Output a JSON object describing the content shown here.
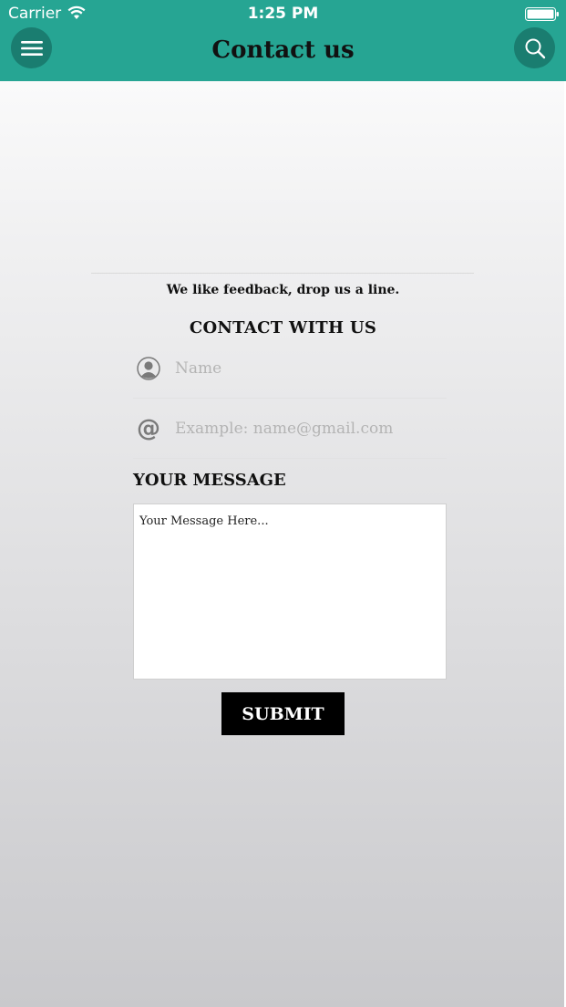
{
  "status_bar": {
    "carrier": "Carrier",
    "time": "1:25 PM"
  },
  "header": {
    "title": "Contact us",
    "menu_icon": "hamburger-menu-icon",
    "search_icon": "search-icon",
    "color": "#26a593"
  },
  "content": {
    "tagline": "We like feedback, drop us a line.",
    "section_title": "CONTACT WITH US",
    "name_field": {
      "icon": "user-icon",
      "placeholder": "Name",
      "value": ""
    },
    "email_field": {
      "icon": "at-icon",
      "icon_glyph": "@",
      "placeholder": "Example: name@gmail.com",
      "value": ""
    },
    "message_label": "YOUR MESSAGE",
    "message_placeholder": "Your Message Here...",
    "submit_label": "SUBMIT"
  }
}
